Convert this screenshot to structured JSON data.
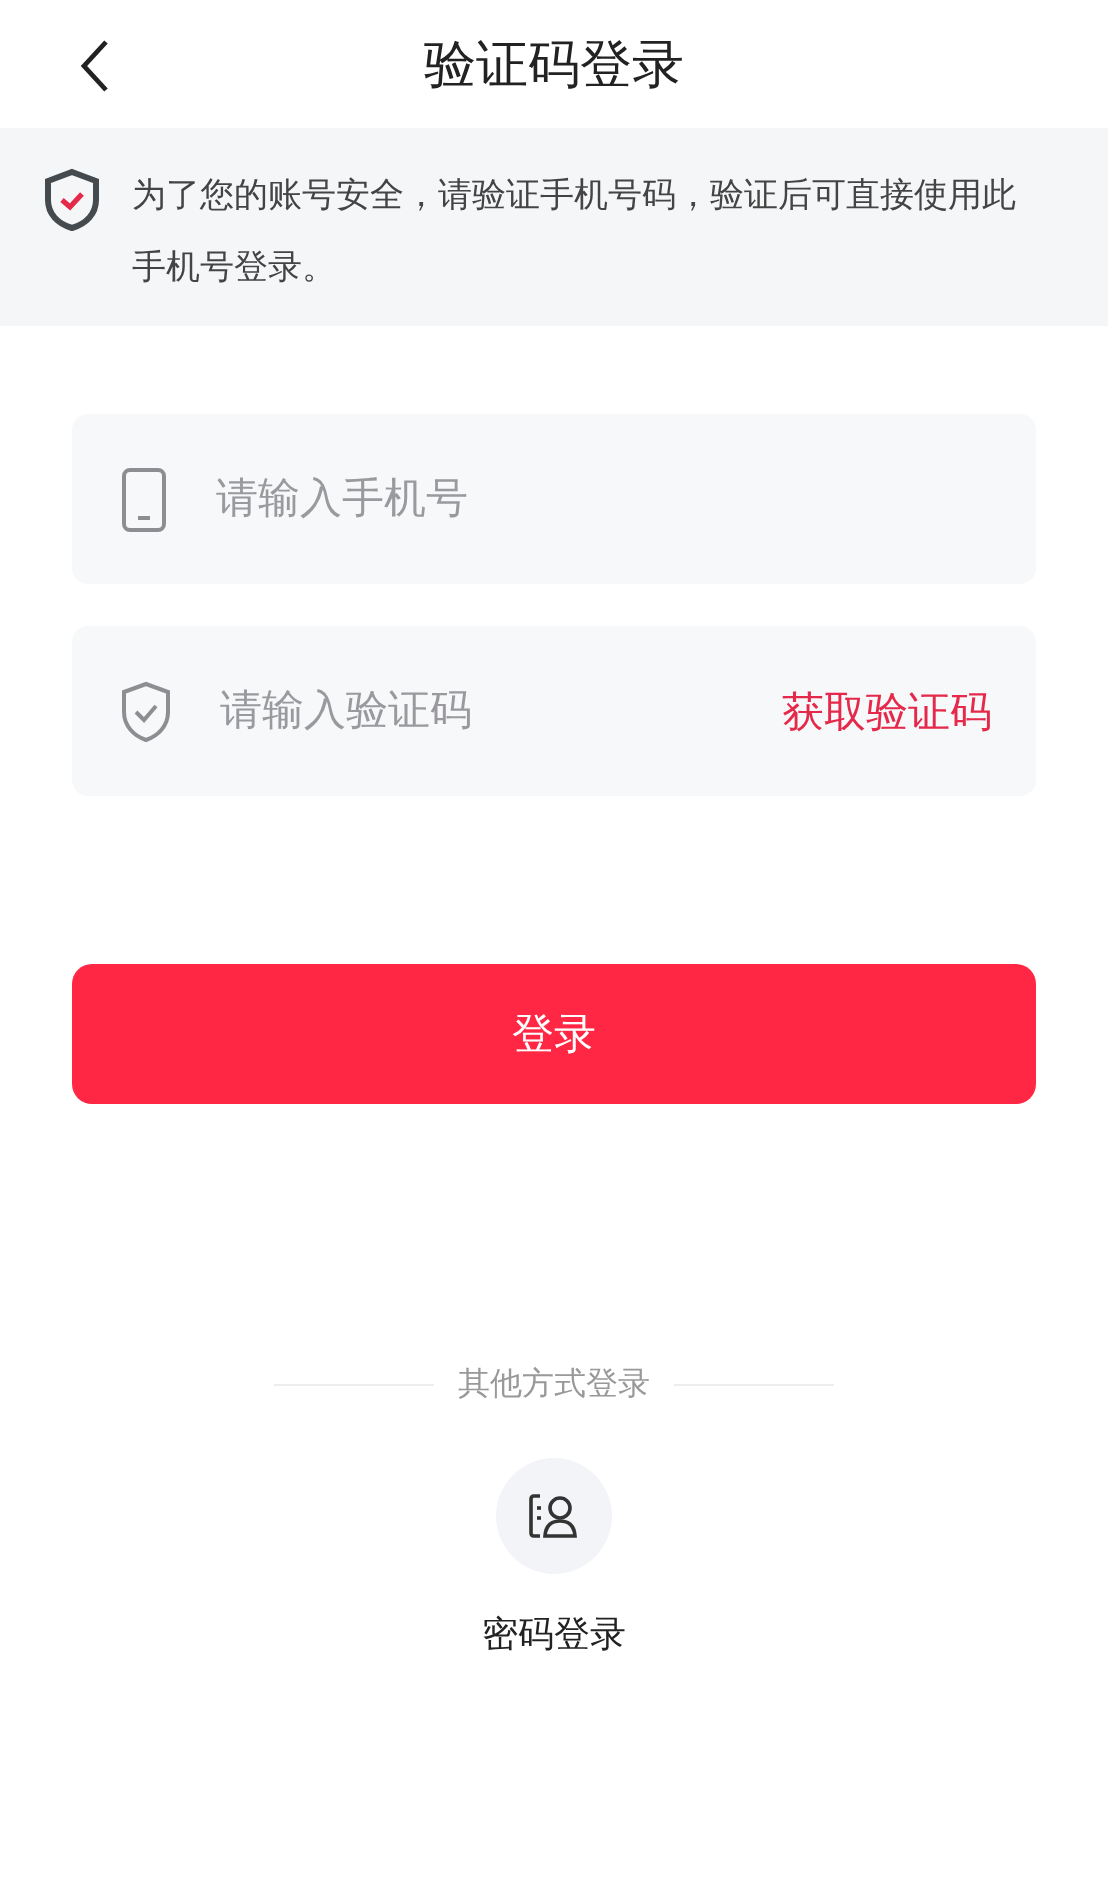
{
  "header": {
    "title": "验证码登录"
  },
  "notice": {
    "text": "为了您的账号安全，请验证手机号码，验证后可直接使用此手机号登录。"
  },
  "fields": [
    {
      "kind": "phone",
      "placeholder": "请输入手机号"
    },
    {
      "kind": "code",
      "placeholder": "请输入验证码",
      "action": "获取验证码"
    }
  ],
  "login_button": "登录",
  "other_login": {
    "heading": "其他方式登录",
    "options": [
      {
        "label": "密码登录"
      }
    ]
  }
}
